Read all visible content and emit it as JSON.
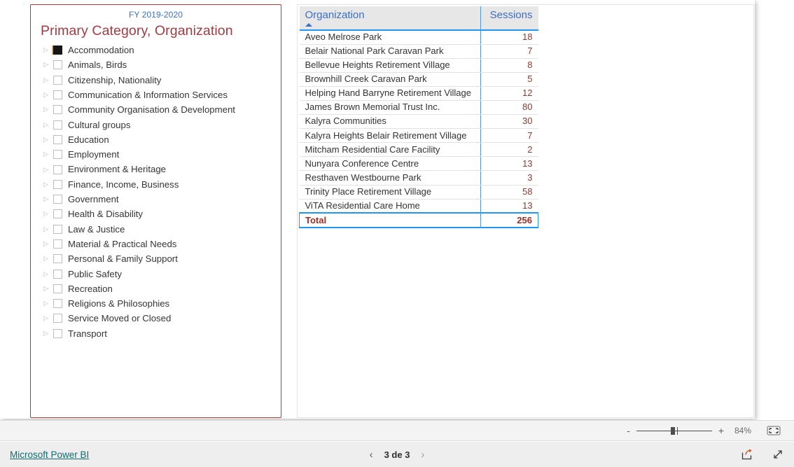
{
  "report": {
    "fiscal_year": "FY 2019-2020",
    "slicer_title": "Primary Category, Organization",
    "slicer_items": [
      {
        "label": "Accommodation",
        "selected": true
      },
      {
        "label": "Animals, Birds",
        "selected": false
      },
      {
        "label": "Citizenship, Nationality",
        "selected": false
      },
      {
        "label": "Communication & Information Services",
        "selected": false
      },
      {
        "label": "Community Organisation & Development",
        "selected": false
      },
      {
        "label": "Cultural groups",
        "selected": false
      },
      {
        "label": "Education",
        "selected": false
      },
      {
        "label": "Employment",
        "selected": false
      },
      {
        "label": "Environment & Heritage",
        "selected": false
      },
      {
        "label": "Finance, Income, Business",
        "selected": false
      },
      {
        "label": "Government",
        "selected": false
      },
      {
        "label": "Health & Disability",
        "selected": false
      },
      {
        "label": "Law & Justice",
        "selected": false
      },
      {
        "label": "Material & Practical Needs",
        "selected": false
      },
      {
        "label": "Personal & Family Support",
        "selected": false
      },
      {
        "label": "Public Safety",
        "selected": false
      },
      {
        "label": "Recreation",
        "selected": false
      },
      {
        "label": "Religions & Philosophies",
        "selected": false
      },
      {
        "label": "Service Moved or Closed",
        "selected": false
      },
      {
        "label": "Transport",
        "selected": false
      }
    ],
    "expander_glyph": "▷"
  },
  "chart_data": {
    "type": "table",
    "title": "Organization Sessions",
    "columns": [
      "Organization",
      "Sessions"
    ],
    "sort": {
      "column": "Organization",
      "direction": "ascending"
    },
    "categories": [
      "Aveo Melrose Park",
      "Belair National Park Caravan Park",
      "Bellevue Heights Retirement Village",
      "Brownhill Creek Caravan Park",
      "Helping Hand Barryne Retirement Village",
      "James Brown Memorial Trust Inc.",
      "Kalyra Communities",
      "Kalyra Heights Belair Retirement Village",
      "Mitcham Residential Care Facility",
      "Nunyara Conference Centre",
      "Resthaven Westbourne Park",
      "Trinity Place Retirement Village",
      "ViTA Residential Care Home"
    ],
    "values": [
      18,
      7,
      8,
      5,
      12,
      80,
      30,
      7,
      2,
      13,
      3,
      58,
      13
    ],
    "total_label": "Total",
    "total_value": 256,
    "xlabel": "Organization",
    "ylabel": "Sessions"
  },
  "statusbar": {
    "zoom_out_label": "-",
    "zoom_in_label": "+",
    "zoom_percent": "84%"
  },
  "footer": {
    "brand": "Microsoft Power BI",
    "prev_glyph": "‹",
    "next_glyph": "›",
    "page_label": "3 de 3"
  },
  "colors": {
    "slicer_border": "#b33a3a",
    "slicer_title": "#a03c42",
    "fiscal_year": "#3c6fc4",
    "header_text": "#3c6fc4",
    "grid_accent": "#2196f3",
    "value_text": "#8c3b33",
    "total_text": "#9c2f24",
    "brand_link": "#116b72"
  }
}
